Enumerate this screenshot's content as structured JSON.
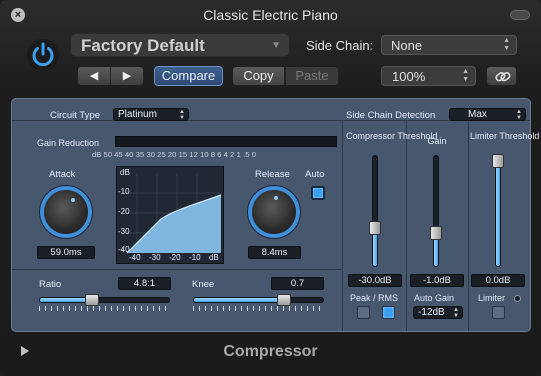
{
  "window": {
    "title": "Classic Electric Piano",
    "plugin_name": "Compressor"
  },
  "header": {
    "preset": "Factory Default",
    "side_chain_label": "Side Chain:",
    "side_chain_value": "None",
    "compare_label": "Compare",
    "copy_label": "Copy",
    "paste_label": "Paste",
    "zoom_value": "100%",
    "prev_icon": "◀",
    "next_icon": "▶"
  },
  "panel": {
    "circuit_type_label": "Circuit Type",
    "circuit_type_value": "Platinum",
    "side_chain_detection_label": "Side Chain Detection",
    "side_chain_detection_value": "Max",
    "gain_reduction_label": "Gain Reduction",
    "gain_reduction_scale": "dB  50  45  40  35  30  25  20  15  12  10   8   6   4   2   1  .5   0",
    "attack_label": "Attack",
    "attack_value": "59.0ms",
    "release_label": "Release",
    "release_value": "8.4ms",
    "auto_label": "Auto",
    "auto_on": true,
    "graph": {
      "y_ticks": [
        "dB",
        "-10",
        "-20",
        "-30",
        "-40"
      ],
      "x_ticks": [
        "-40",
        "-30",
        "-20",
        "-10",
        "dB"
      ]
    },
    "ratio_label": "Ratio",
    "ratio_value": "4.8:1",
    "ratio_level": 0.4,
    "knee_label": "Knee",
    "knee_value": "0.7",
    "knee_level": 0.7,
    "compressor_threshold_label": "Compressor Threshold",
    "compressor_threshold_value": "-30.0dB",
    "compressor_threshold_level": 0.35,
    "gain_label": "Gain",
    "gain_value": "-1.0dB",
    "gain_level": 0.3,
    "limiter_threshold_label": "Limiter Threshold",
    "limiter_threshold_value": "0.0dB",
    "limiter_threshold_level": 0.98,
    "peak_rms_label": "Peak / RMS",
    "auto_gain_label": "Auto Gain",
    "auto_gain_value": "-12dB",
    "limiter_label": "Limiter"
  },
  "colors": {
    "panel": "#47586e",
    "accent": "#3aa0f0",
    "compare": "#2d4a73"
  }
}
